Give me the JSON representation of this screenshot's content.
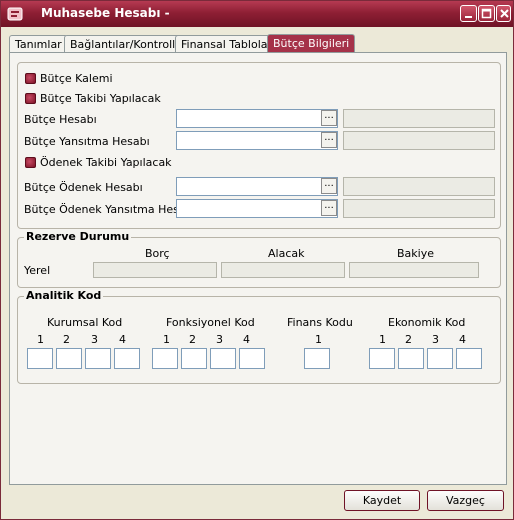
{
  "window": {
    "title": "Muhasebe Hesabı -"
  },
  "tabs": [
    {
      "label": "Tanımlar"
    },
    {
      "label": "Bağlantılar/Kontroller"
    },
    {
      "label": "Finansal Tablolar"
    },
    {
      "label": "Bütçe Bilgileri",
      "active": true
    }
  ],
  "budget": {
    "cb_kalemi": "Bütçe Kalemi",
    "cb_takibi": "Bütçe Takibi Yapılacak",
    "hesabi_label": "Bütçe Hesabı",
    "yansitma_label": "Bütçe Yansıtma Hesabı",
    "cb_odenek": "Ödenek Takibi Yapılacak",
    "odenek_label": "Bütçe Ödenek Hesabı",
    "odenek_yansitma_label": "Bütçe Ödenek Yansıtma Hesabı",
    "lookup_glyph": "..."
  },
  "reserve": {
    "title": "Rezerve Durumu",
    "col_borc": "Borç",
    "col_alacak": "Alacak",
    "col_bakiye": "Bakiye",
    "row_label": "Yerel"
  },
  "analytic": {
    "title": "Analitik Kod",
    "kurumsal": "Kurumsal Kod",
    "fonksiyonel": "Fonksiyonel Kod",
    "finans": "Finans Kodu",
    "ekonomik": "Ekonomik Kod",
    "n1": "1",
    "n2": "2",
    "n3": "3",
    "n4": "4"
  },
  "buttons": {
    "save": "Kaydet",
    "cancel": "Vazgeç"
  }
}
